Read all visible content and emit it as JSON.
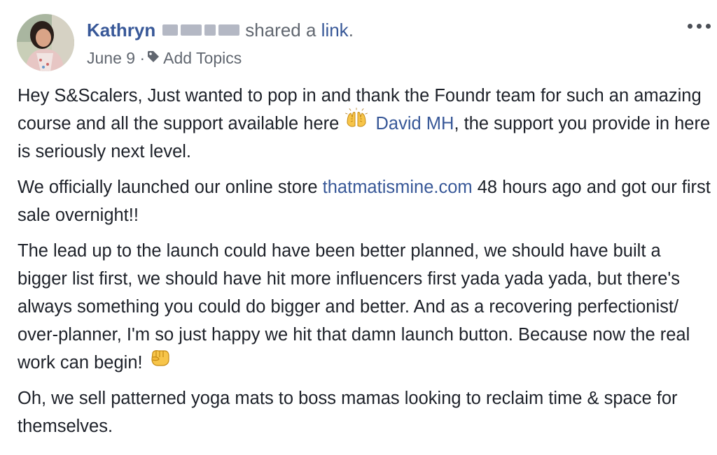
{
  "post": {
    "author": {
      "first_name": "Kathryn"
    },
    "action_text": "shared a",
    "action_link": "link",
    "action_end": ".",
    "date": "June 9",
    "separator": "·",
    "add_topics": "Add Topics",
    "paragraphs": {
      "p1": {
        "text_a": "Hey S&Scalers, Just wanted to pop in and thank the Foundr team for such an amazing course and all the support available here",
        "emoji": "raising-hands-emoji",
        "mention": "David MH",
        "text_b": ", the support you provide in here is seriously next level."
      },
      "p2": {
        "text_a": "We officially launched our online store",
        "link": "thatmatismine.com",
        "text_b": "48 hours ago and got our first sale overnight!!"
      },
      "p3": {
        "text_a": "The lead up to the launch could have been better planned, we should have built a bigger list first, we should have hit more influencers first yada yada yada, but there's always something you could do bigger and better. And as a recovering perfectionist/ over-planner, I'm so just happy we hit that damn launch button. Because now the real work can begin!",
        "emoji": "oncoming-fist-emoji"
      },
      "p4": {
        "text_a": "Oh, we sell patterned yoga mats to boss mamas looking to reclaim time & space for themselves."
      }
    },
    "colors": {
      "link": "#385898",
      "muted": "#616770",
      "text": "#1d2129"
    }
  },
  "icons": {
    "more": "more-options-icon",
    "tag": "tag-icon"
  }
}
